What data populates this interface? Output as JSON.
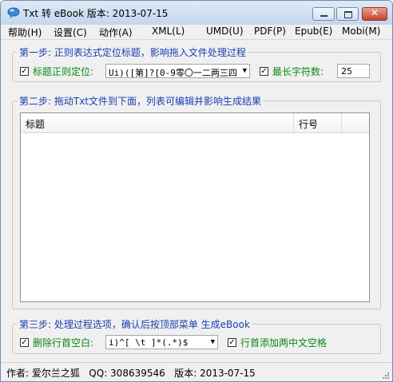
{
  "window": {
    "title": "Txt 转 eBook 版本: 2013-07-15",
    "close_glyph": "✕"
  },
  "menu": [
    "帮助(H)",
    "设置(C)",
    "动作(A)",
    "XML(L)",
    "UMD(U)",
    "PDF(P)",
    "Epub(E)",
    "Mobi(M)"
  ],
  "step1": {
    "legend": "第一步: 正则表达式定位标题，影响拖入文件处理过程",
    "title_regex_label": "标题正则定位:",
    "title_regex_checked": true,
    "title_regex_value": "Ui)([第]?[0-9零〇一二两三四",
    "max_chars_label": "最长字符数:",
    "max_chars_checked": true,
    "max_chars_value": "25"
  },
  "step2": {
    "legend": "第二步: 拖动Txt文件到下面，列表可编辑并影响生成结果",
    "columns": [
      "标题",
      "行号"
    ],
    "rows": []
  },
  "step3": {
    "legend": "第三步: 处理过程选项，确认后按顶部菜单 生成eBook",
    "trim_label": "删除行首空白:",
    "trim_checked": true,
    "trim_regex_value": "i)^[ \\t  ]*(.*)$",
    "add_space_label": "行首添加两中文空格",
    "add_space_checked": true
  },
  "status": {
    "text": "作者: 爱尔兰之狐   QQ: 308639546   版本: 2013-07-15"
  },
  "colors": {
    "legend": "#1a3fb0",
    "option_label": "#098a15"
  },
  "check_glyph": "✓",
  "dropdown_glyph": "▼"
}
